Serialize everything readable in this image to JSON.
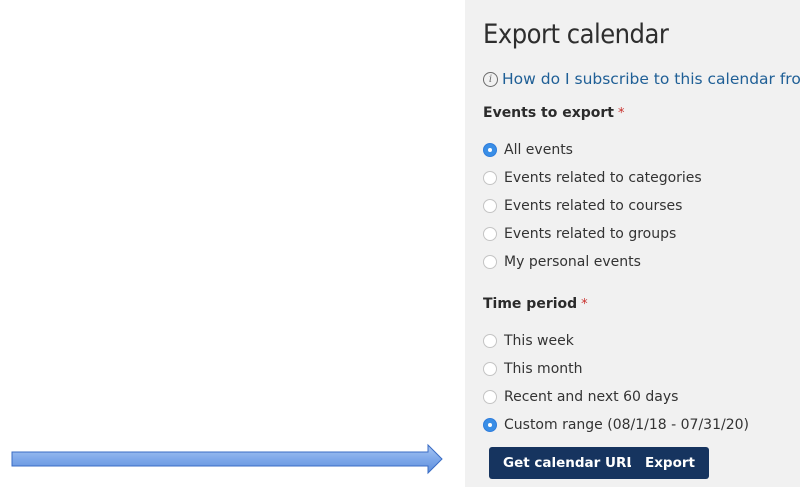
{
  "title": "Export calendar",
  "help_link": "How do I subscribe to this calendar from",
  "events_section": {
    "label": "Events to export",
    "required_marker": "*",
    "options": [
      {
        "label": "All events",
        "checked": true
      },
      {
        "label": "Events related to categories",
        "checked": false
      },
      {
        "label": "Events related to courses",
        "checked": false
      },
      {
        "label": "Events related to groups",
        "checked": false
      },
      {
        "label": "My personal events",
        "checked": false
      }
    ]
  },
  "time_section": {
    "label": "Time period",
    "required_marker": "*",
    "options": [
      {
        "label": "This week",
        "checked": false
      },
      {
        "label": "This month",
        "checked": false
      },
      {
        "label": "Recent and next 60 days",
        "checked": false
      },
      {
        "label": "Custom range (08/1/18 - 07/31/20)",
        "checked": true
      }
    ]
  },
  "buttons": {
    "get_url": "Get calendar URL",
    "export": "Export"
  },
  "colors": {
    "panel_bg": "#f1f1f1",
    "link": "#1f5f96",
    "required": "#c9302c",
    "radio_checked": "#3a8ee6",
    "button_bg": "#16345f",
    "arrow_fill": "#6e9ee6",
    "arrow_stroke": "#3a6cc4"
  },
  "icons": {
    "help": "info-circle-icon",
    "annotation": "right-arrow-icon"
  }
}
